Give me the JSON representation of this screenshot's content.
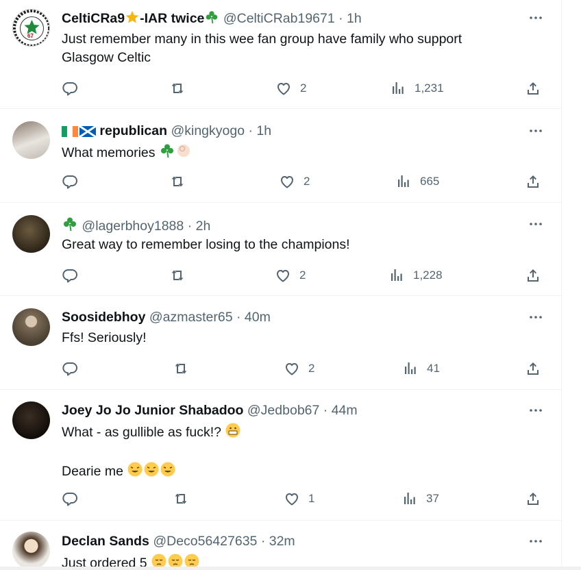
{
  "tweets": [
    {
      "name": "CeltiCRa9",
      "name_tail": "-IAR twice",
      "handle": "@CeltiCRab19671",
      "sep": "·",
      "time": "1h",
      "text_lines": [
        "Just remember many in this wee fan group have family who support",
        "Glasgow Celtic"
      ],
      "likes": "2",
      "views": "1,231",
      "avatar_badge": "67"
    },
    {
      "name": "republican",
      "handle": "@kingkyogo",
      "sep": "·",
      "time": "1h",
      "text_lines": [
        "What memories"
      ],
      "likes": "2",
      "views": "665"
    },
    {
      "handle": "@lagerbhoy1888",
      "sep": "·",
      "time": "2h",
      "text_lines": [
        "Great way to remember losing to the champions!"
      ],
      "likes": "2",
      "views": "1,228"
    },
    {
      "name": "Soosidebhoy",
      "handle": "@azmaster65",
      "sep": "·",
      "time": "40m",
      "text_lines": [
        "Ffs! Seriously!"
      ],
      "likes": "2",
      "views": "41"
    },
    {
      "name": "Joey Jo Jo Junior Shabadoo",
      "handle": "@Jedbob67",
      "sep": "·",
      "time": "44m",
      "text_lines": [
        "What - as gullible as fuck!?",
        "Dearie me"
      ],
      "likes": "1",
      "views": "37"
    },
    {
      "name": "Declan Sands",
      "handle": "@Deco56427635",
      "sep": "·",
      "time": "32m",
      "text_lines": [
        "Just ordered 5"
      ]
    }
  ],
  "more_label": "···",
  "colors": {
    "text": "#0f1419",
    "secondary": "#536471",
    "divider": "#eff3f4",
    "shamrock": "#2e9e3e",
    "star": "#f5b60f"
  },
  "icons": [
    "reply-icon",
    "retweet-icon",
    "like-icon",
    "views-icon",
    "share-icon",
    "more-icon",
    "shamrock-emoji",
    "star-emoji",
    "ireland-flag",
    "scotland-flag",
    "grimace-emoji",
    "rofl-emoji",
    "pensive-emoji",
    "ok-hand-emoji"
  ]
}
